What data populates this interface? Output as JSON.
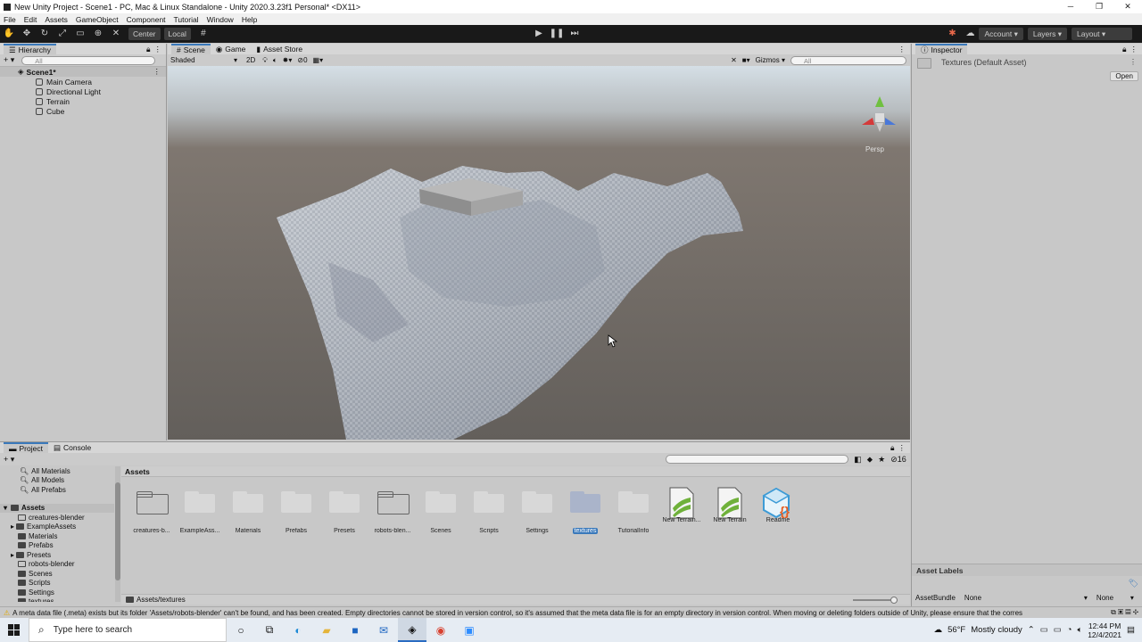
{
  "window": {
    "title": "New Unity Project - Scene1 - PC, Mac & Linux Standalone - Unity 2020.3.23f1 Personal* <DX11>",
    "minimize": "─",
    "maximize": "❐",
    "close": "✕"
  },
  "menu": [
    "File",
    "Edit",
    "Assets",
    "GameObject",
    "Component",
    "Tutorial",
    "Window",
    "Help"
  ],
  "toolbar": {
    "pivot": "Center",
    "space": "Local",
    "account": "Account",
    "layers": "Layers",
    "layout": "Layout"
  },
  "hierarchy": {
    "tab": "Hierarchy",
    "search_placeholder": "All",
    "scene": "Scene1*",
    "items": [
      "Main Camera",
      "Directional Light",
      "Terrain",
      "Cube"
    ]
  },
  "scene": {
    "tabs": [
      "Scene",
      "Game",
      "Asset Store"
    ],
    "shading": "Shaded",
    "mode2d": "2D",
    "hidden_count": "0",
    "gizmos": "Gizmos",
    "search_placeholder": "All",
    "persp": "Persp"
  },
  "inspector": {
    "tab": "Inspector",
    "asset_title": "Textures (Default Asset)",
    "open_button": "Open",
    "asset_labels": "Asset Labels",
    "asset_bundle": "AssetBundle",
    "bundle_value": "None",
    "variant_value": "None"
  },
  "project": {
    "tabs": [
      "Project",
      "Console"
    ],
    "favorites": [
      "All Materials",
      "All Models",
      "All Prefabs"
    ],
    "root": "Assets",
    "tree": [
      "creatures-blender",
      "ExampleAssets",
      "Materials",
      "Prefabs",
      "Presets",
      "robots-blender",
      "Scenes",
      "Scripts",
      "Settings",
      "textures"
    ],
    "breadcrumb": "Assets",
    "badge": "16",
    "path": "Assets/textures",
    "assets": [
      {
        "label": "creatures-b...",
        "kind": "folder-empty"
      },
      {
        "label": "ExampleAss...",
        "kind": "folder"
      },
      {
        "label": "Materials",
        "kind": "folder"
      },
      {
        "label": "Prefabs",
        "kind": "folder"
      },
      {
        "label": "Presets",
        "kind": "folder"
      },
      {
        "label": "robots-blen...",
        "kind": "folder-empty"
      },
      {
        "label": "Scenes",
        "kind": "folder"
      },
      {
        "label": "Scripts",
        "kind": "folder"
      },
      {
        "label": "Settings",
        "kind": "folder"
      },
      {
        "label": "textures",
        "kind": "folder-selected"
      },
      {
        "label": "TutorialInfo",
        "kind": "folder"
      },
      {
        "label": "New Terrain...",
        "kind": "terrain"
      },
      {
        "label": "New Terrain",
        "kind": "terrain"
      },
      {
        "label": "Readme",
        "kind": "readme"
      }
    ]
  },
  "status": {
    "message": "A meta data file (.meta) exists but its folder 'Assets/robots-blender' can't be found, and has been created. Empty directories cannot be stored in version control, so it's assumed that the meta data file is for an empty directory in version control. When moving or deleting folders outside of Unity, please ensure that the corres"
  },
  "taskbar": {
    "search_placeholder": "Type here to search",
    "weather_temp": "56°F",
    "weather_desc": "Mostly cloudy",
    "time": "12:44 PM",
    "date": "12/4/2021"
  }
}
